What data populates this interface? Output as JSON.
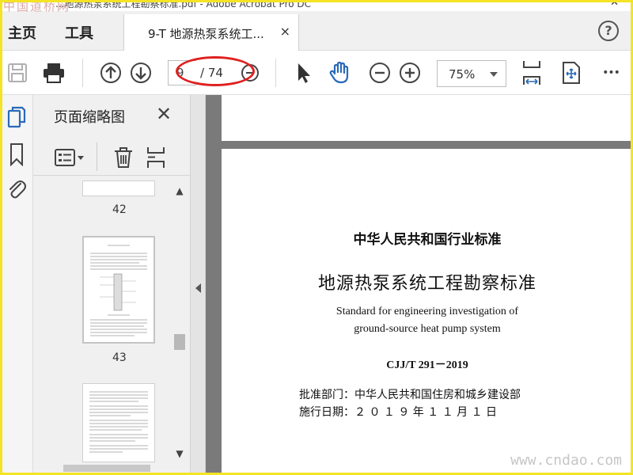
{
  "window": {
    "title": "...地源热泵系统工程勘察标准.pdf - Adobe Acrobat Pro DC",
    "close_glyph": "✕"
  },
  "watermarks": {
    "top_left": "中国道桥网",
    "bottom_right": "www.cndao.com"
  },
  "menubar": {
    "home_label": "主页",
    "tools_label": "工具",
    "doc_tab_title": "9-T 地源热泵系统工...",
    "doc_tab_close": "×",
    "help_glyph": "?"
  },
  "toolbar": {
    "current_page": "9",
    "total_pages": "/ 74",
    "zoom_value": "75%",
    "more_glyph": "•••"
  },
  "thumbnails_panel": {
    "title": "页面缩略图",
    "close_glyph": "✕",
    "pages": [
      {
        "number": "42"
      },
      {
        "number": "43"
      }
    ],
    "scroll_up": "▲",
    "scroll_down": "▼"
  },
  "document": {
    "line1": "中华人民共和国行业标准",
    "line2": "地源热泵系统工程勘察标准",
    "english1": "Standard for engineering investigation of",
    "english2": "ground-source heat pump system",
    "code": "CJJ/T 291－2019",
    "approval_dept": "批准部门：中华人民共和国住房和城乡建设部",
    "effective_date": "施行日期：２ ０ １ ９ 年 １ １ 月 １ 日"
  },
  "colors": {
    "frame": "#f4e425",
    "annotation_oval": "#e02020",
    "icon_blue": "#2a6ab8",
    "doc_bg": "#7a7a7a"
  }
}
